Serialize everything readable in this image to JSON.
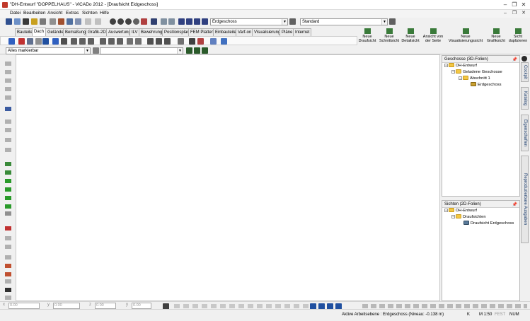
{
  "window": {
    "title": "\"DH-Entwurf \"DOPPELHAUS\" - ViCADo 2012 - [Draufsicht Eidgeschoss]",
    "minimize": "–",
    "restore": "❐",
    "close": "✕",
    "doc_minimize": "–",
    "doc_restore": "❐",
    "doc_close": "✕"
  },
  "menu": {
    "items": [
      "Datei",
      "Bearbeiten",
      "Ansicht",
      "Extras",
      "Sichten",
      "Hilfe"
    ]
  },
  "toolbar": {
    "floor_select": "Erdgeschoss",
    "style_select": "Standard"
  },
  "tabs": [
    "Bauteile",
    "Dach",
    "Gelände",
    "Bemaßung",
    "Grafik-2D",
    "Auswertung",
    "ILV",
    "Bewehrung",
    "Positionsplan",
    "FEM Platten",
    "Einbauteile",
    "Varf-on",
    "Visualisierung",
    "Pläne",
    "Internet"
  ],
  "big_buttons": [
    {
      "label1": "Neue",
      "label2": "Draufsicht"
    },
    {
      "label1": "Neue",
      "label2": "Schnittsicht"
    },
    {
      "label1": "Neue",
      "label2": "Detailsicht"
    },
    {
      "label1": "Ansicht von",
      "label2": "der Seite"
    },
    {
      "label1": "Neue",
      "label2": "Visualisierungssicht"
    },
    {
      "label1": "Neue",
      "label2": "Grafiksicht"
    },
    {
      "label1": "Sicht",
      "label2": "duplizieren"
    }
  ],
  "selection": {
    "filter_select": "Alles markierbar"
  },
  "panels": {
    "geschosse": {
      "title": "Geschosse (3D-Folien)",
      "pin": "📌",
      "tree": [
        {
          "label": "DH-Entwurf",
          "exp": "−"
        },
        {
          "label": "Geladene Geschosse",
          "exp": "−"
        },
        {
          "label": "Abschnitt 1",
          "exp": "−"
        },
        {
          "label": "Erdgeschoss",
          "exp": ""
        }
      ]
    },
    "sichten": {
      "title": "Sichten (2D-Folien)",
      "pin": "📌",
      "tree": [
        {
          "label": "DH-Entwurf",
          "exp": "−"
        },
        {
          "label": "Draufsichten",
          "exp": "−"
        },
        {
          "label": "Draufsicht Erdgeschoss",
          "exp": ""
        }
      ]
    }
  },
  "side_tabs": [
    "Cockpit",
    "Katalog",
    "Eigenschaften",
    "Reproduzierbare Ausgaben"
  ],
  "coords": {
    "labels": [
      "x",
      "y",
      "z",
      "y"
    ],
    "values": [
      "0.00",
      "0.00",
      "0.00",
      "0.00"
    ]
  },
  "status": {
    "active_plane": "Aktive Arbeitsebene : Erdgeschoss (Niveau: -0.138 m)",
    "k": "K",
    "scale": "M 1:50",
    "fest": "FEST",
    "num": "NUM"
  },
  "colors": {
    "accent": "#1a3c6e",
    "folder": "#f3c744",
    "canvas": "#ffffff"
  }
}
